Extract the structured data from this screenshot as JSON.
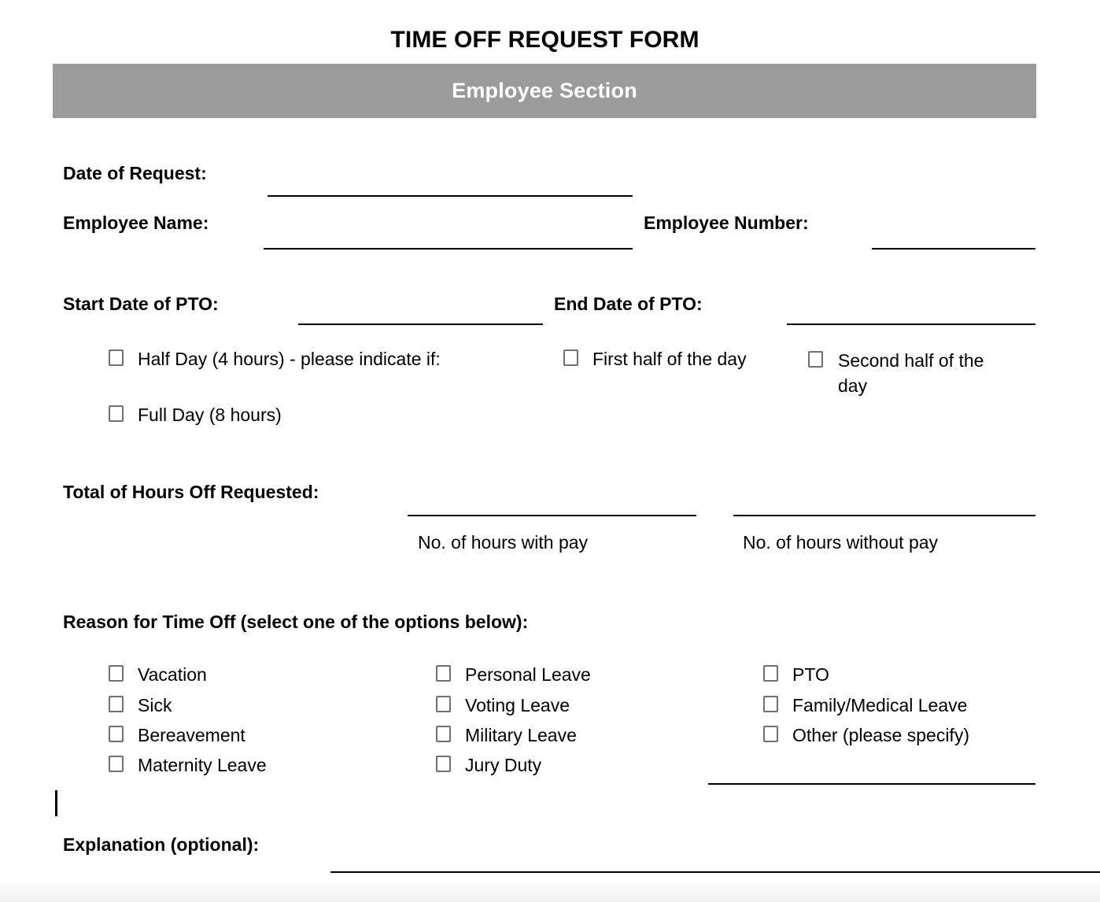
{
  "document": {
    "title": "TIME OFF REQUEST FORM",
    "section_header": "Employee Section"
  },
  "colors": {
    "section_bar_bg": "#9b9b9b",
    "section_bar_text": "#ffffff",
    "rule": "#000000",
    "checkbox_border": "#6f6f6f",
    "page_bg": "#ffffff"
  },
  "fields": {
    "date_of_request": {
      "label": "Date of Request:",
      "value": ""
    },
    "employee_name": {
      "label": "Employee Name:",
      "value": ""
    },
    "employee_number": {
      "label": "Employee Number:",
      "value": ""
    },
    "start_date_pto": {
      "label": "Start Date of PTO:",
      "value": ""
    },
    "end_date_pto": {
      "label": "End Date of PTO:",
      "value": ""
    },
    "total_hours": {
      "label": "Total of Hours Off Requested:"
    },
    "hours_with_pay": {
      "caption": "No. of hours with pay",
      "value": ""
    },
    "hours_without_pay": {
      "caption": "No. of hours without pay",
      "value": ""
    },
    "other_specify": {
      "value": ""
    },
    "explanation": {
      "label": "Explanation (optional):",
      "value": ""
    }
  },
  "day_options": [
    {
      "id": "half-day",
      "label": "Half Day (4 hours) - please indicate if:",
      "checked": false
    },
    {
      "id": "first-half-of-day",
      "label": "First half of the day",
      "checked": false
    },
    {
      "id": "second-half-of-day",
      "label": "Second half of the day",
      "checked": false
    },
    {
      "id": "full-day",
      "label": "Full Day (8 hours)",
      "checked": false
    }
  ],
  "reason": {
    "heading": "Reason for Time Off (select one of the options below):",
    "column_1": [
      {
        "id": "vacation",
        "label": "Vacation",
        "checked": false
      },
      {
        "id": "sick",
        "label": "Sick",
        "checked": false
      },
      {
        "id": "bereavement",
        "label": "Bereavement",
        "checked": false
      },
      {
        "id": "maternity-leave",
        "label": "Maternity Leave",
        "checked": false
      }
    ],
    "column_2": [
      {
        "id": "personal-leave",
        "label": "Personal Leave",
        "checked": false
      },
      {
        "id": "voting-leave",
        "label": "Voting Leave",
        "checked": false
      },
      {
        "id": "military-leave",
        "label": "Military Leave",
        "checked": false
      },
      {
        "id": "jury-duty",
        "label": "Jury Duty",
        "checked": false
      }
    ],
    "column_3": [
      {
        "id": "pto",
        "label": "PTO",
        "checked": false
      },
      {
        "id": "family-medical-leave",
        "label": "Family/Medical Leave",
        "checked": false
      },
      {
        "id": "other-please-specify",
        "label": "Other (please specify)",
        "checked": false
      }
    ]
  }
}
